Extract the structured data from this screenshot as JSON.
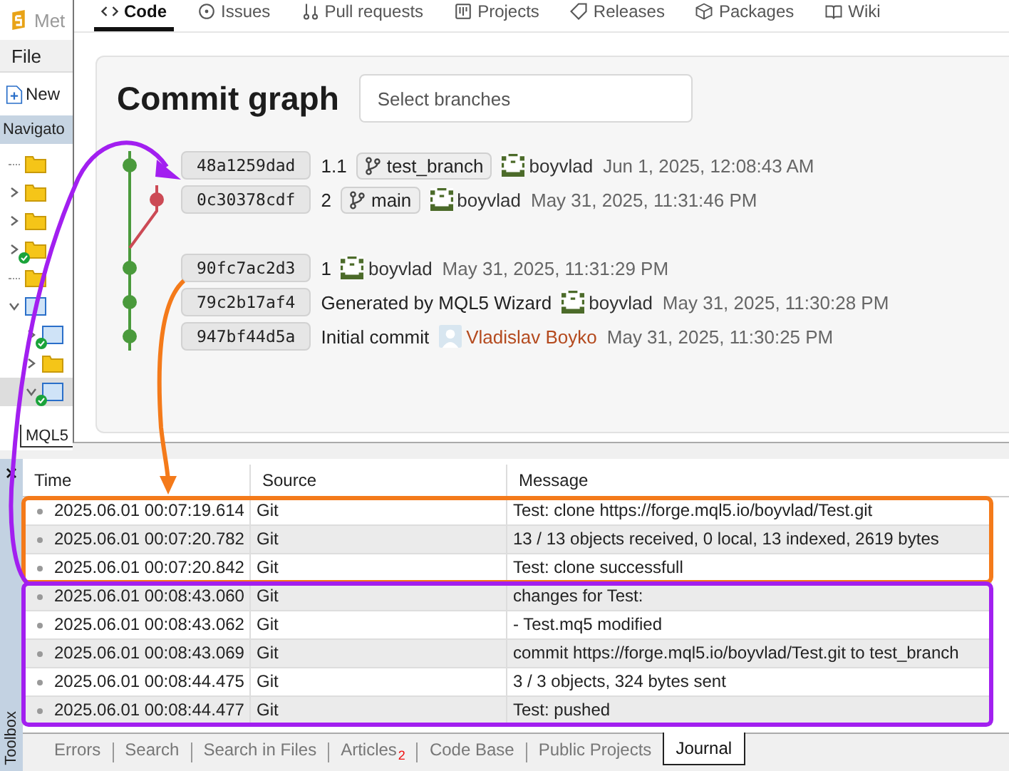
{
  "editor": {
    "title": "Met",
    "menu": [
      "File"
    ],
    "toolbar": [
      {
        "label": "New"
      }
    ],
    "navigator": {
      "title": "Navigato",
      "items": [
        {
          "kind": "folder",
          "synced": false,
          "selected": false
        },
        {
          "kind": "folder",
          "expanded": false,
          "synced": false,
          "selected": false
        },
        {
          "kind": "folder",
          "expanded": false,
          "synced": false,
          "selected": false
        },
        {
          "kind": "folder",
          "expanded": false,
          "synced": true,
          "selected": false
        },
        {
          "kind": "folder",
          "synced": false,
          "selected": false
        },
        {
          "kind": "project",
          "expanded": true,
          "synced": false,
          "selected": false,
          "children": [
            {
              "kind": "project",
              "expanded": false,
              "synced": true,
              "selected": false
            },
            {
              "kind": "folder",
              "expanded": false,
              "synced": false,
              "selected": false
            },
            {
              "kind": "project",
              "expanded": true,
              "synced": true,
              "selected": true
            }
          ]
        }
      ]
    },
    "bottom_tab": {
      "label": "MQL5",
      "selected": true
    }
  },
  "browser": {
    "tabs": [
      {
        "label": "Code",
        "kind": "code",
        "selected": true
      },
      {
        "label": "Issues",
        "kind": "issue",
        "selected": false
      },
      {
        "label": "Pull requests",
        "kind": "pull",
        "selected": false
      },
      {
        "label": "Projects",
        "kind": "project",
        "selected": false
      },
      {
        "label": "Releases",
        "kind": "tag",
        "selected": false
      },
      {
        "label": "Packages",
        "kind": "package",
        "selected": false
      },
      {
        "label": "Wiki",
        "kind": "book",
        "selected": false
      }
    ],
    "commit_graph": {
      "title": "Commit graph",
      "branch_select": {
        "placeholder": "Select branches"
      },
      "commits": [
        {
          "hash": "48a1259dad",
          "node": {
            "kind": "main",
            "color": "#4a9a3c"
          },
          "merge_after": false,
          "label": "1.1",
          "branch": "test_branch",
          "author": {
            "kind": "identicon",
            "name": "boyvlad",
            "link": false
          },
          "date": "Jun 1, 2025, 12:08:43 AM"
        },
        {
          "hash": "0c30378cdf",
          "node": {
            "kind": "side",
            "color": "#cc4a55"
          },
          "merge_after": true,
          "label": "2",
          "branch": "main",
          "author": {
            "kind": "identicon",
            "name": "boyvlad",
            "link": false
          },
          "date": "May 31, 2025, 11:31:46 PM"
        },
        {
          "hash": "90fc7ac2d3",
          "node": {
            "kind": "main",
            "color": "#4a9a3c"
          },
          "merge_after": false,
          "label": "1",
          "author": {
            "kind": "identicon",
            "name": "boyvlad",
            "link": false
          },
          "date": "May 31, 2025, 11:31:29 PM"
        },
        {
          "hash": "79c2b17af4",
          "node": {
            "kind": "main",
            "color": "#4a9a3c"
          },
          "merge_after": false,
          "label": "Generated by MQL5 Wizard",
          "author": {
            "kind": "identicon",
            "name": "boyvlad",
            "link": false
          },
          "date": "May 31, 2025, 11:30:28 PM"
        },
        {
          "hash": "947bf44d5a",
          "node": {
            "kind": "main",
            "color": "#4a9a3c"
          },
          "merge_after": false,
          "label": "Initial commit",
          "author": {
            "kind": "placeholder",
            "name": "Vladislav Boyko",
            "link": true
          },
          "date": "May 31, 2025, 11:30:25 PM"
        }
      ]
    }
  },
  "toolbox": {
    "title": "Toolbox",
    "journal": {
      "columns": [
        "Time",
        "Source",
        "Message"
      ],
      "groups": [
        {
          "color": "#f47a1a",
          "kind": "from_commit",
          "rows": [
            {
              "time": "2025.06.01 00:07:19.614",
              "source": "Git",
              "message": "Test: clone https://forge.mql5.io/boyvlad/Test.git"
            },
            {
              "time": "2025.06.01 00:07:20.782",
              "source": "Git",
              "message": "13 / 13 objects received, 0 local, 13 indexed, 2619 bytes"
            },
            {
              "time": "2025.06.01 00:07:20.842",
              "source": "Git",
              "message": "Test: clone successfull"
            }
          ]
        },
        {
          "color": "#a21ff0",
          "kind": "to_commit",
          "rows": [
            {
              "time": "2025.06.01 00:08:43.060",
              "source": "Git",
              "message": "changes for Test:"
            },
            {
              "time": "2025.06.01 00:08:43.062",
              "source": "Git",
              "message": " - Test.mq5 modified"
            },
            {
              "time": "2025.06.01 00:08:43.069",
              "source": "Git",
              "message": "commit https://forge.mql5.io/boyvlad/Test.git to test_branch"
            },
            {
              "time": "2025.06.01 00:08:44.475",
              "source": "Git",
              "message": "3 / 3 objects, 324 bytes sent"
            },
            {
              "time": "2025.06.01 00:08:44.477",
              "source": "Git",
              "message": "Test: pushed"
            }
          ]
        }
      ]
    },
    "tabs": [
      {
        "label": "Errors",
        "selected": false
      },
      {
        "label": "Search",
        "selected": false
      },
      {
        "label": "Search in Files",
        "selected": false
      },
      {
        "label": "Articles",
        "badge": "2",
        "selected": false
      },
      {
        "label": "Code Base",
        "selected": false
      },
      {
        "label": "Public Projects",
        "selected": false
      },
      {
        "label": "Journal",
        "selected": true
      }
    ]
  }
}
